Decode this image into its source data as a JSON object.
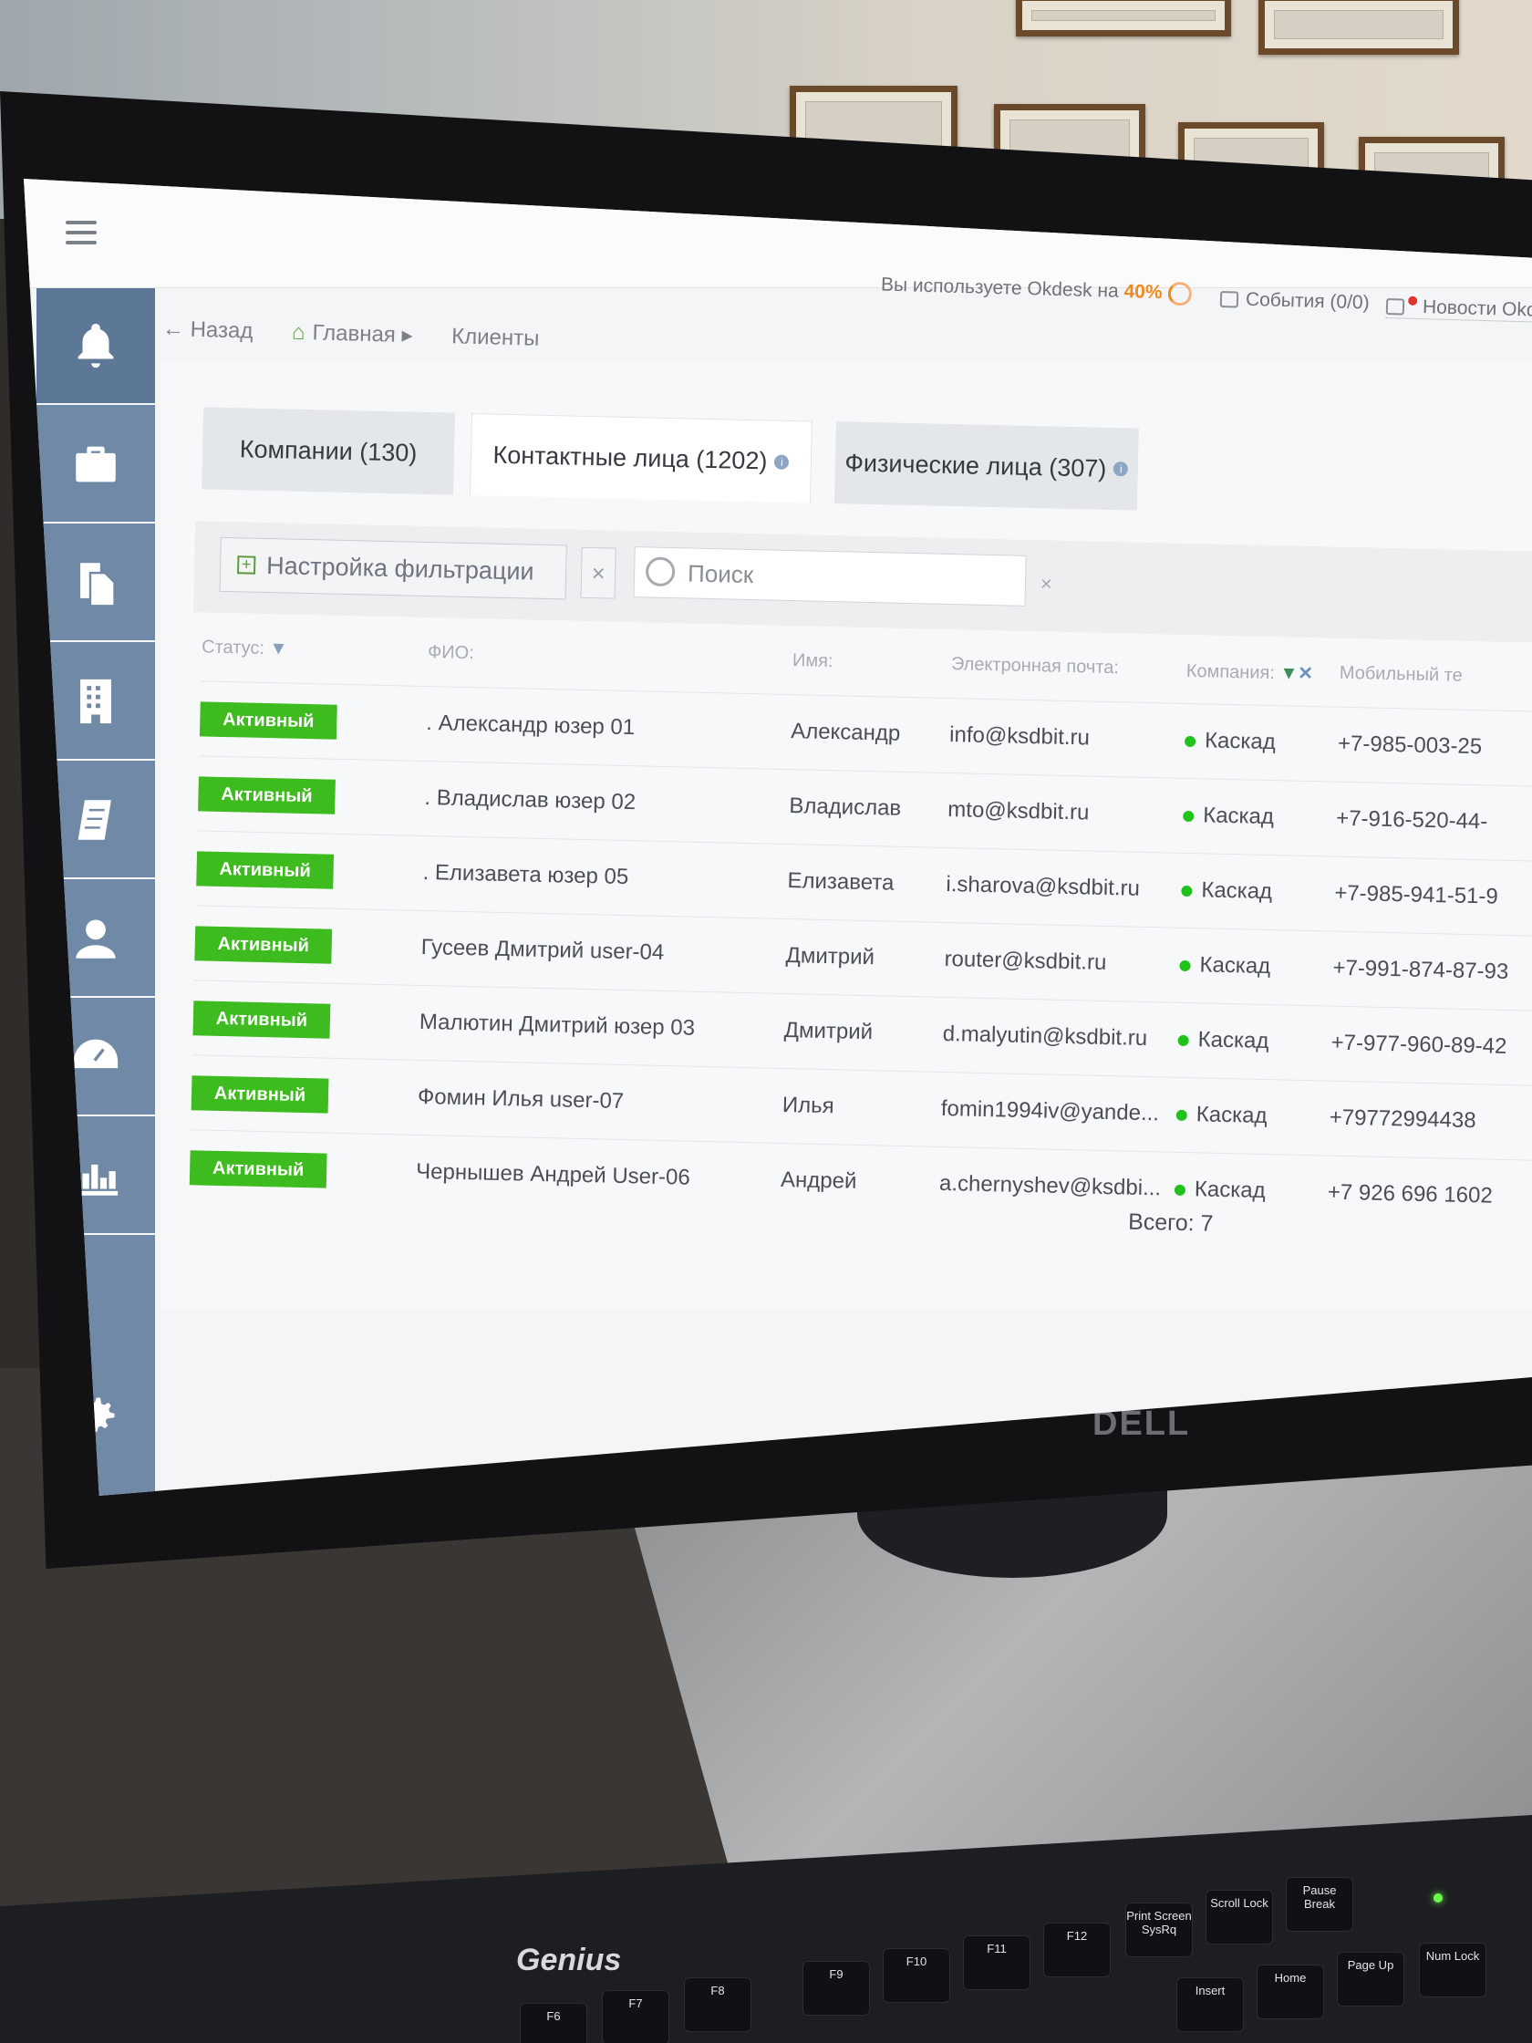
{
  "topbar": {
    "usage_prefix": "Вы используете Okdesk на",
    "usage_percent": "40%",
    "events_label": "События (0/0)",
    "news_label": "Новости Okdesk"
  },
  "breadcrumb": {
    "back": "← Назад",
    "home": "Главная ▸",
    "current": "Клиенты"
  },
  "tabs": [
    {
      "label": "Компании (130)"
    },
    {
      "label": "Контактные лица (1202)"
    },
    {
      "label": "Физические лица (307)"
    }
  ],
  "filter": {
    "settings_label": "Настройка фильтрации",
    "clear_label": "×",
    "search_placeholder": "Поиск",
    "search_clear": "×"
  },
  "table": {
    "columns": [
      "Статус:",
      "ФИО:",
      "Имя:",
      "Электронная почта:",
      "Компания:",
      "Мобильный те"
    ],
    "rows": [
      {
        "status": "Активный",
        "fio": ". Александр юзер 01",
        "name": "Александр",
        "email": "info@ksdbit.ru",
        "company": "Каскад",
        "phone": "+7-985-003-25"
      },
      {
        "status": "Активный",
        "fio": ". Владислав юзер 02",
        "name": "Владислав",
        "email": "mto@ksdbit.ru",
        "company": "Каскад",
        "phone": "+7-916-520-44-"
      },
      {
        "status": "Активный",
        "fio": ". Елизавета юзер 05",
        "name": "Елизавета",
        "email": "i.sharova@ksdbit.ru",
        "company": "Каскад",
        "phone": "+7-985-941-51-9"
      },
      {
        "status": "Активный",
        "fio": "Гусеев Дмитрий user-04",
        "name": "Дмитрий",
        "email": "router@ksdbit.ru",
        "company": "Каскад",
        "phone": "+7-991-874-87-93"
      },
      {
        "status": "Активный",
        "fio": "Малютин Дмитрий юзер 03",
        "name": "Дмитрий",
        "email": "d.malyutin@ksdbit.ru",
        "company": "Каскад",
        "phone": "+7-977-960-89-42"
      },
      {
        "status": "Активный",
        "fio": "Фомин Илья user-07",
        "name": "Илья",
        "email": "fomin1994iv@yande...",
        "company": "Каскад",
        "phone": "+79772994438"
      },
      {
        "status": "Активный",
        "fio": "Чернышев Андрей User-06",
        "name": "Андрей",
        "email": "a.chernyshev@ksdbi...",
        "company": "Каскад",
        "phone": "+7 926 696 1602"
      }
    ],
    "total": "Всего: 7"
  },
  "sidebar": {
    "items": [
      "bell-icon",
      "briefcase-icon",
      "documents-icon",
      "building-icon",
      "book-icon",
      "user-icon",
      "dashboard-icon",
      "chart-icon"
    ],
    "bottom": "gear-icon"
  },
  "hardware": {
    "monitor_brand": "DELL",
    "keyboard_brand": "Genius",
    "keys": [
      "F6",
      "F7",
      "F8",
      "F9",
      "F10",
      "F11",
      "F12",
      "Print Screen SysRq",
      "Scroll Lock",
      "Pause Break",
      "Insert",
      "Home",
      "Page Up",
      "Num Lock"
    ]
  },
  "colors": {
    "sidebar": "#6f89a6",
    "status_active": "#3dbb1f",
    "accent_orange": "#f28a1b",
    "company_dot": "#22c21c"
  }
}
